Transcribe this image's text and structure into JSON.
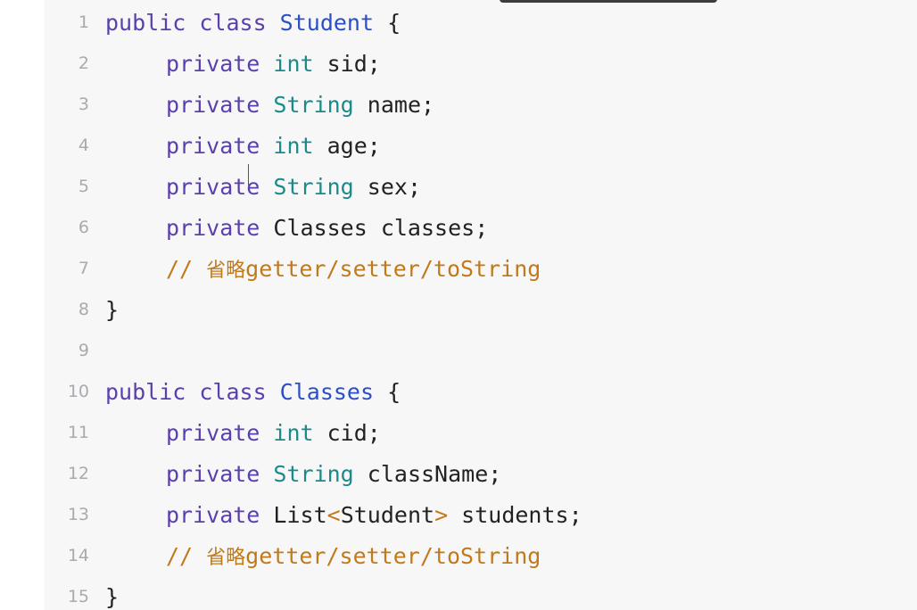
{
  "lines": [
    {
      "n": "1",
      "parts": [
        {
          "t": "public class ",
          "c": "kw"
        },
        {
          "t": "Student",
          "c": "cls"
        },
        {
          "t": " {",
          "c": "plain"
        }
      ]
    },
    {
      "n": "2",
      "parts": [
        {
          "t": "private ",
          "c": "kw"
        },
        {
          "t": "int",
          "c": "type"
        },
        {
          "t": " sid;",
          "c": "plain"
        }
      ],
      "indent": true
    },
    {
      "n": "3",
      "parts": [
        {
          "t": "private ",
          "c": "kw"
        },
        {
          "t": "String",
          "c": "type"
        },
        {
          "t": " name;",
          "c": "plain"
        }
      ],
      "indent": true
    },
    {
      "n": "4",
      "parts": [
        {
          "t": "private ",
          "c": "kw"
        },
        {
          "t": "int",
          "c": "type"
        },
        {
          "t": " age;",
          "c": "plain"
        }
      ],
      "indent": true
    },
    {
      "n": "5",
      "parts": [
        {
          "t": "private ",
          "c": "kw"
        },
        {
          "t": "String",
          "c": "type"
        },
        {
          "t": " sex;",
          "c": "plain"
        }
      ],
      "indent": true
    },
    {
      "n": "6",
      "parts": [
        {
          "t": "private ",
          "c": "kw"
        },
        {
          "t": "Classes classes;",
          "c": "plain"
        }
      ],
      "indent": true
    },
    {
      "n": "7",
      "parts": [
        {
          "t": "// ",
          "c": "cmt"
        },
        {
          "t": "省略",
          "c": "cjk"
        },
        {
          "t": "getter/setter/toString",
          "c": "cmt"
        }
      ],
      "indent": true
    },
    {
      "n": "8",
      "parts": [
        {
          "t": "}",
          "c": "plain"
        }
      ]
    },
    {
      "n": "9",
      "parts": []
    },
    {
      "n": "10",
      "parts": [
        {
          "t": "public class ",
          "c": "kw"
        },
        {
          "t": "Classes",
          "c": "cls"
        },
        {
          "t": " {",
          "c": "plain"
        }
      ]
    },
    {
      "n": "11",
      "parts": [
        {
          "t": "private ",
          "c": "kw"
        },
        {
          "t": "int",
          "c": "type"
        },
        {
          "t": " cid;",
          "c": "plain"
        }
      ],
      "indent": true
    },
    {
      "n": "12",
      "parts": [
        {
          "t": "private ",
          "c": "kw"
        },
        {
          "t": "String",
          "c": "type"
        },
        {
          "t": " className;",
          "c": "plain"
        }
      ],
      "indent": true
    },
    {
      "n": "13",
      "parts": [
        {
          "t": "private ",
          "c": "kw"
        },
        {
          "t": "List",
          "c": "plain"
        },
        {
          "t": "<",
          "c": "cmt"
        },
        {
          "t": "Student",
          "c": "plain"
        },
        {
          "t": ">",
          "c": "cmt"
        },
        {
          "t": " students;",
          "c": "plain"
        }
      ],
      "indent": true
    },
    {
      "n": "14",
      "parts": [
        {
          "t": "// ",
          "c": "cmt"
        },
        {
          "t": "省略",
          "c": "cjk"
        },
        {
          "t": "getter/setter/toString",
          "c": "cmt"
        }
      ],
      "indent": true
    },
    {
      "n": "15",
      "parts": [
        {
          "t": "}",
          "c": "plain"
        }
      ]
    }
  ]
}
